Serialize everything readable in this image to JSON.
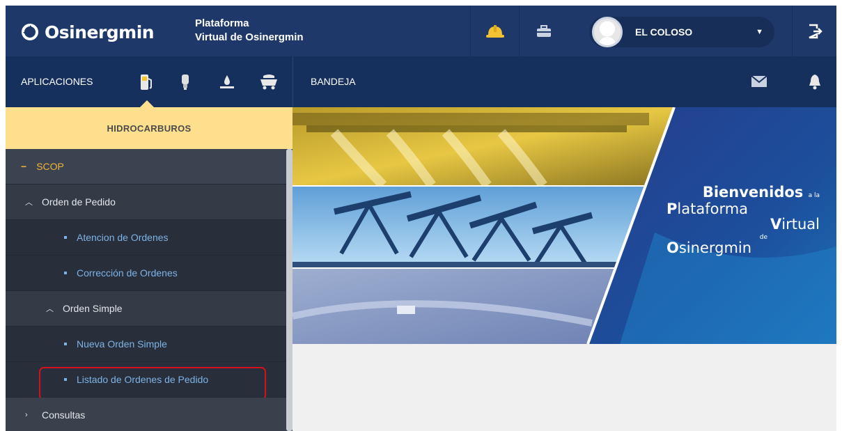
{
  "header": {
    "logo_text": "Osinergmin",
    "platform_line1": "Plataforma",
    "platform_line2": "Virtual de Osinergmin",
    "icons": [
      "helmet-icon",
      "briefcase-icon"
    ],
    "user_name": "EL COLOSO",
    "colors": {
      "bar": "#1e3969",
      "accent": "#fddf8e",
      "highlight": "#d7101c"
    }
  },
  "subbar": {
    "apps_label": "APLICACIONES",
    "app_icons": [
      "fuel-pump-icon",
      "bulb-icon",
      "oil-drop-icon",
      "mining-cart-icon"
    ],
    "inbox_label": "BANDEJA"
  },
  "sidebar": {
    "section_title": "HIDROCARBUROS",
    "items": [
      {
        "label": "SCOP",
        "marker": "−"
      },
      {
        "label": "Orden de Pedido",
        "marker": "^"
      },
      {
        "label": "Atencion de Ordenes"
      },
      {
        "label": "Corrección de Ordenes"
      },
      {
        "label": "Orden Simple",
        "marker": "^"
      },
      {
        "label": "Nueva Orden Simple"
      },
      {
        "label": "Listado de Ordenes de Pedido",
        "highlighted": true
      },
      {
        "label": "Consultas",
        "marker": ">"
      }
    ]
  },
  "banner": {
    "line1_big": "Bienvenidos",
    "line1_small": "a la",
    "line2_initial": "P",
    "line2_rest": "lataforma",
    "line3_small": "de",
    "line3_initial": "V",
    "line3_rest": "irtual",
    "line4_initial": "O",
    "line4_rest": "sinergmin"
  }
}
